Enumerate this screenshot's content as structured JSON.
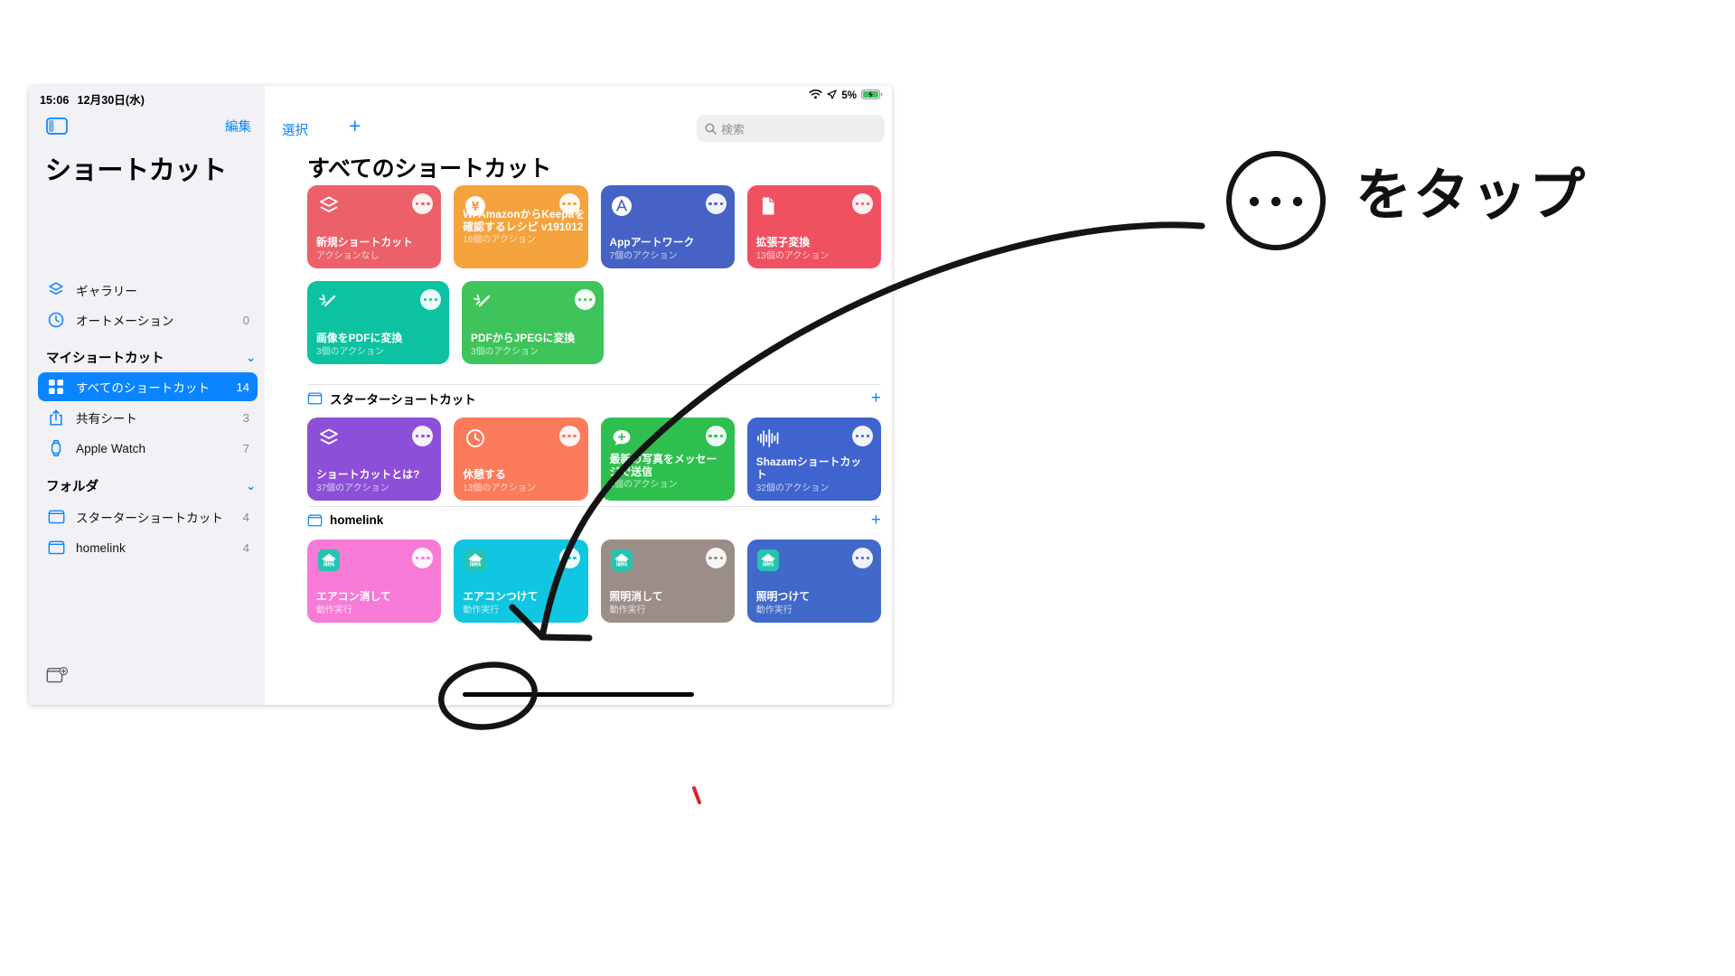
{
  "status_bar": {
    "time": "15:06",
    "date": "12月30日(水)",
    "battery_percent": "5%",
    "wifi_icon": "wifi-icon",
    "location_icon": "location-arrow-icon",
    "battery_icon": "battery-charging-icon"
  },
  "sidebar": {
    "toggle_icon": "sidebar-toggle-icon",
    "edit_label": "編集",
    "app_title": "ショートカット",
    "new_folder_icon": "new-folder-icon",
    "top_items": [
      {
        "label": "ギャラリー",
        "icon": "gallery-stack-icon",
        "count": ""
      },
      {
        "label": "オートメーション",
        "icon": "automation-clock-icon",
        "count": "0"
      }
    ],
    "my_shortcuts": {
      "header": "マイショートカット",
      "chevron": "chevron-down-icon",
      "items": [
        {
          "label": "すべてのショートカット",
          "icon": "grid-squares-icon",
          "count": "14",
          "selected": true
        },
        {
          "label": "共有シート",
          "icon": "share-sheet-icon",
          "count": "3",
          "selected": false
        },
        {
          "label": "Apple Watch",
          "icon": "apple-watch-icon",
          "count": "7",
          "selected": false
        }
      ]
    },
    "folders": {
      "header": "フォルダ",
      "chevron": "chevron-down-icon",
      "items": [
        {
          "label": "スターターショートカット",
          "icon": "folder-icon",
          "count": "4"
        },
        {
          "label": "homelink",
          "icon": "folder-icon",
          "count": "4"
        }
      ]
    }
  },
  "toolbar": {
    "select_label": "選択",
    "add_icon": "plus-icon",
    "search_icon": "search-icon",
    "search_placeholder": "検索",
    "search_value": ""
  },
  "main": {
    "page_title": "すべてのショートカット",
    "sections": [
      {
        "id": "all-shortcuts",
        "header": null,
        "cards": [
          {
            "name": "新規ショートカット",
            "sub": "アクションなし",
            "color": "#ec6069",
            "icon": "stack-layers-icon",
            "menu_icon": "ellipsis-icon"
          },
          {
            "name": "W. AmazonからKeepaを確認するレシピ v191012",
            "sub": "16個のアクション",
            "color": "#f5a council",
            "icon": "yen-coin-icon",
            "menu_icon": "ellipsis-icon"
          },
          {
            "name": "Appアートワーク",
            "sub": "7個のアクション",
            "color": "#4562c4",
            "icon": "app-store-icon",
            "menu_icon": "ellipsis-icon"
          },
          {
            "name": "拡張子変換",
            "sub": "13個のアクション",
            "color": "#ef5161",
            "icon": "document-icon",
            "menu_icon": "ellipsis-icon"
          },
          {
            "name": "画像をPDFに変換",
            "sub": "3個のアクション",
            "color": "#0dc2a0",
            "icon": "sparkle-wand-icon",
            "menu_icon": "ellipsis-icon"
          },
          {
            "name": "PDFからJPEGに変換",
            "sub": "3個のアクション",
            "color": "#3fc45c",
            "icon": "sparkle-wand-icon",
            "menu_icon": "ellipsis-icon"
          }
        ]
      },
      {
        "id": "starter-shortcuts",
        "header": "スターターショートカット",
        "header_icon": "folder-icon",
        "add_icon": "plus-icon",
        "cards": [
          {
            "name": "ショートカットとは?",
            "sub": "37個のアクション",
            "color": "#8b4fd8",
            "icon": "stack-layers-icon",
            "menu_icon": "ellipsis-icon"
          },
          {
            "name": "休憩する",
            "sub": "13個のアクション",
            "color": "#fc7b5a",
            "icon": "clock-icon",
            "menu_icon": "ellipsis-icon"
          },
          {
            "name": "最新の写真をメッセージで送信",
            "sub": "2個のアクション",
            "color": "#2fbf4f",
            "icon": "message-plus-icon",
            "menu_icon": "ellipsis-icon"
          },
          {
            "name": "Shazamショートカット",
            "sub": "32個のアクション",
            "color": "#3f63cf",
            "icon": "waveform-icon",
            "menu_icon": "ellipsis-icon"
          }
        ]
      },
      {
        "id": "homelink",
        "header": "homelink",
        "header_icon": "folder-icon",
        "add_icon": "plus-icon",
        "cards": [
          {
            "name": "エアコン消して",
            "sub": "動作実行",
            "color": "#f77ad6",
            "icon": "homelink-app-icon",
            "menu_icon": "ellipsis-icon"
          },
          {
            "name": "エアコンつけて",
            "sub": "動作実行",
            "color": "#11c6e0",
            "icon": "homelink-app-icon",
            "menu_icon": "ellipsis-icon"
          },
          {
            "name": "照明消して",
            "sub": "動作実行",
            "color": "#9b8d88",
            "icon": "homelink-app-icon",
            "menu_icon": "ellipsis-icon"
          },
          {
            "name": "照明つけて",
            "sub": "動作実行",
            "color": "#4169c9",
            "icon": "homelink-app-icon",
            "menu_icon": "ellipsis-icon"
          }
        ]
      }
    ]
  },
  "annotation": {
    "text": "をタップ",
    "circle_icon": "ellipsis-circle-annotation",
    "arrow_icon": "curved-arrow-annotation",
    "highlight_icon": "circle-highlight-annotation"
  },
  "colors": {
    "accent": "#0a84ff",
    "sidebar_bg": "#f1f1f6",
    "selected_row": "#0a84ff"
  }
}
